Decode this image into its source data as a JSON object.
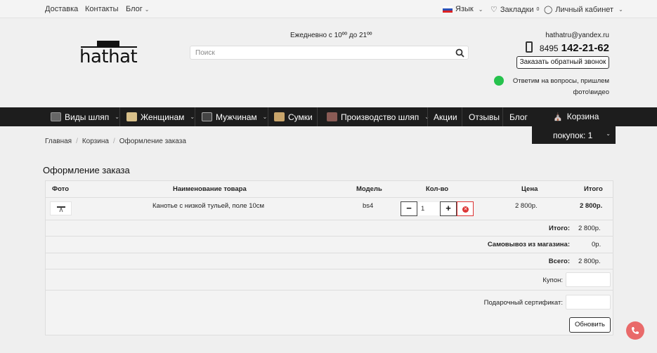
{
  "topbar": {
    "delivery": "Доставка",
    "contacts": "Контакты",
    "blog": "Блог",
    "language": "Язык",
    "bookmarks": "Закладки",
    "bookmarks_count": "0",
    "account": "Личный кабинет"
  },
  "header": {
    "logo": "hathat",
    "hours": "Ежедневно с 10ºº до 21ºº",
    "search_placeholder": "Поиск",
    "email": "hathatru@yandex.ru",
    "phone_prefix": "8495",
    "phone_number": "142-21-62",
    "callback": "Заказать обратный звонок",
    "whatsapp_line1": "Ответим на вопросы, пришлем",
    "whatsapp_line2": "фото\\видео"
  },
  "nav": {
    "items": [
      "Виды шляп",
      "Женщинам",
      "Мужчинам",
      "Сумки",
      "Производство шляп",
      "Акции",
      "Отзывы",
      "Блог"
    ],
    "cart": "Корзина",
    "purchases": "покупок: 1"
  },
  "breadcrumbs": [
    "Главная",
    "Корзина",
    "Оформление заказа"
  ],
  "page_title": "Оформление заказа",
  "table": {
    "headers": {
      "photo": "Фото",
      "name": "Наименование товара",
      "model": "Модель",
      "qty": "Кол-во",
      "price": "Цена",
      "total": "Итого"
    },
    "rows": [
      {
        "name": "Канотье с низкой тульей, поле 10см",
        "model": "bs4",
        "qty": "1",
        "price": "2 800р.",
        "total": "2 800р."
      }
    ],
    "summary": [
      {
        "label": "Итого:",
        "value": "2 800р."
      },
      {
        "label": "Самовывоз из магазина:",
        "value": "0р."
      },
      {
        "label": "Всего:",
        "value": "2 800р."
      }
    ],
    "coupon_label": "Купон:",
    "certificate_label": "Подарочный сертификат:",
    "update_button": "Обновить"
  },
  "colors": {
    "nav_bg": "#1d1d1d",
    "accent_red": "#d33333",
    "fab": "#e96a6a"
  }
}
